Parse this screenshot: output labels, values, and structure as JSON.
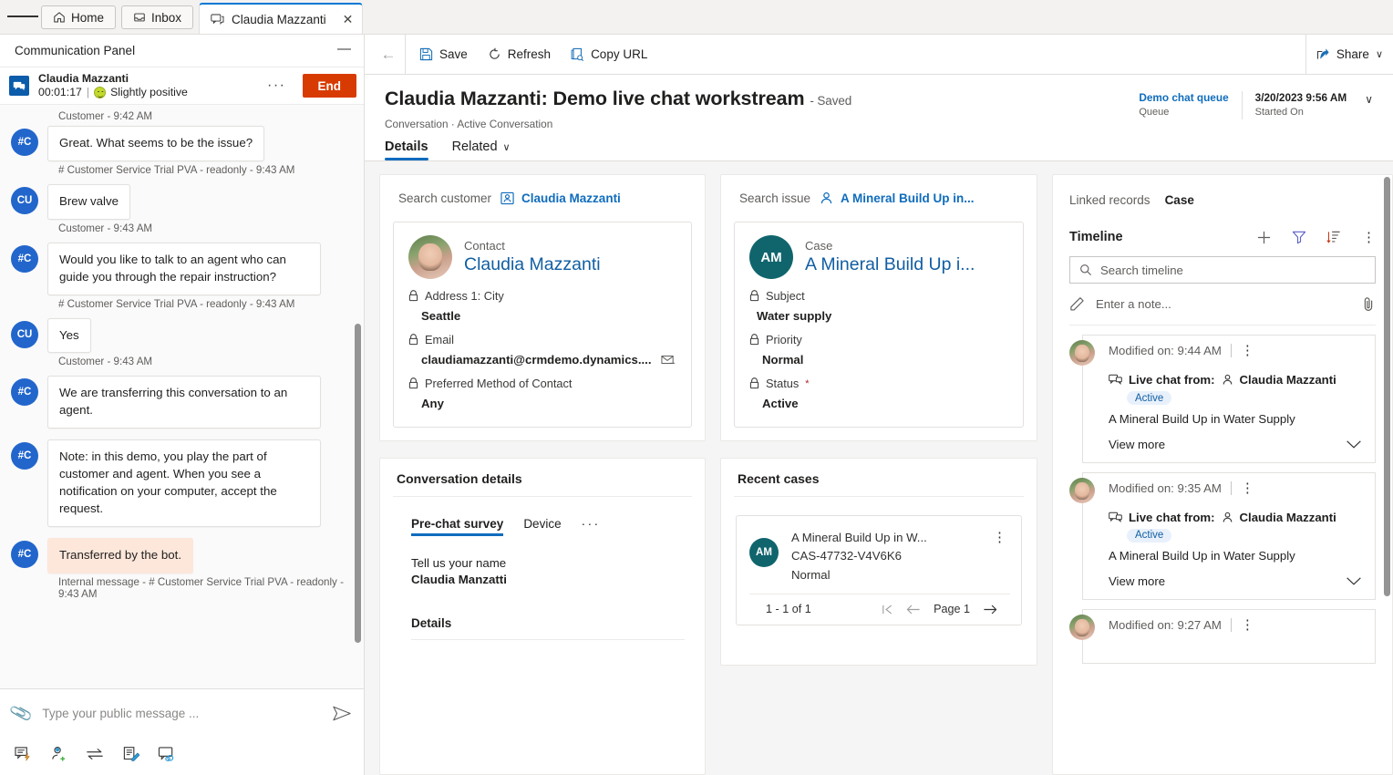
{
  "tabstrip": {
    "menu_icon": "hamburger-icon",
    "tabs": [
      {
        "label": "Home",
        "icon": "home-icon",
        "active": false
      },
      {
        "label": "Inbox",
        "icon": "inbox-icon",
        "active": false
      },
      {
        "label": "Claudia Mazzanti",
        "icon": "chat-icon",
        "active": true,
        "close": "✕"
      }
    ]
  },
  "communication_panel": {
    "title": "Communication Panel",
    "minimize_label": "—",
    "session": {
      "name": "Claudia Mazzanti",
      "timer": "00:01:17",
      "separator": "|",
      "sentiment": "Slightly positive",
      "sentiment_icon": "smiley-icon",
      "overflow_label": "···",
      "end_label": "End"
    },
    "messages": [
      {
        "meta_above": "Customer - 9:42 AM",
        "avatar": "#C",
        "text": "Great. What seems to be the issue?",
        "meta_below": "# Customer Service Trial PVA - readonly - 9:43 AM",
        "internal": false
      },
      {
        "meta_above": "",
        "avatar": "CU",
        "text": "Brew valve",
        "meta_below": "Customer - 9:43 AM",
        "internal": false
      },
      {
        "meta_above": "",
        "avatar": "#C",
        "text": "Would you like to talk to an agent who can guide you through the repair instruction?",
        "meta_below": "# Customer Service Trial PVA - readonly - 9:43 AM",
        "internal": false
      },
      {
        "meta_above": "",
        "avatar": "CU",
        "text": "Yes",
        "meta_below": "Customer - 9:43 AM",
        "internal": false
      },
      {
        "meta_above": "",
        "avatar": "#C",
        "text": "We are transferring this conversation to an agent.",
        "meta_below": "",
        "internal": false
      },
      {
        "meta_above": "",
        "avatar": "#C",
        "text": "Note: in this demo, you play the part of customer and agent. When you see a notification on your computer, accept the request.",
        "meta_below": "",
        "internal": false
      },
      {
        "meta_above": "",
        "avatar": "#C",
        "text": "Transferred by the bot.",
        "meta_below": "Internal message - # Customer Service Trial PVA - readonly - 9:43 AM",
        "internal": true
      }
    ],
    "composer": {
      "attach_icon": "paperclip-icon",
      "placeholder": "Type your public message ...",
      "value": "",
      "send_icon": "send-icon"
    },
    "tools": [
      {
        "name": "quick-reply-icon"
      },
      {
        "name": "consult-icon"
      },
      {
        "name": "transfer-icon"
      },
      {
        "name": "notes-icon"
      },
      {
        "name": "linked-conversation-icon"
      }
    ]
  },
  "command_bar": {
    "back_icon": "back-arrow-icon",
    "buttons": [
      {
        "label": "Save",
        "icon": "save-icon"
      },
      {
        "label": "Refresh",
        "icon": "refresh-icon"
      },
      {
        "label": "Copy URL",
        "icon": "copy-url-icon"
      }
    ],
    "share": {
      "label": "Share",
      "icon": "share-icon",
      "chevron": "∨"
    }
  },
  "record": {
    "title": "Claudia Mazzanti: Demo live chat workstream",
    "saved_state": "- Saved",
    "breadcrumb": "Conversation · Active Conversation",
    "header_fields": [
      {
        "value": "Demo chat queue",
        "label": "Queue",
        "is_link": true
      },
      {
        "value": "3/20/2023 9:56 AM",
        "label": "Started On",
        "is_link": false
      }
    ],
    "header_chevron": "∨",
    "tabs": [
      {
        "label": "Details",
        "active": true,
        "chevron": ""
      },
      {
        "label": "Related",
        "active": false,
        "chevron": "∨"
      }
    ]
  },
  "customer_card": {
    "search_label": "Search customer",
    "search_value": "Claudia Mazzanti",
    "search_icon": "contact-icon",
    "entity_type": "Contact",
    "entity_name": "Claudia Mazzanti",
    "avatar": "photo-avatar",
    "fields": [
      {
        "label": "Address 1: City",
        "value": "Seattle",
        "lock": true,
        "required": false,
        "trailing_icon": ""
      },
      {
        "label": "Email",
        "value": "claudiamazzanti@crmdemo.dynamics....",
        "lock": true,
        "required": false,
        "trailing_icon": "email-icon"
      },
      {
        "label": "Preferred Method of Contact",
        "value": "Any",
        "lock": true,
        "required": false,
        "trailing_icon": ""
      }
    ]
  },
  "case_card": {
    "search_label": "Search issue",
    "search_value": "A Mineral Build Up in...",
    "search_icon": "person-icon",
    "entity_type": "Case",
    "entity_name": "A Mineral Build Up i...",
    "initials": "AM",
    "fields": [
      {
        "label": "Subject",
        "value": "Water supply",
        "lock": true,
        "required": false
      },
      {
        "label": "Priority",
        "value": "Normal",
        "lock": true,
        "required": false
      },
      {
        "label": "Status",
        "value": "Active",
        "lock": true,
        "required": true
      }
    ]
  },
  "conversation_details": {
    "title": "Conversation details",
    "tabs": [
      {
        "label": "Pre-chat survey",
        "active": true
      },
      {
        "label": "Device",
        "active": false
      },
      {
        "label": "···",
        "active": false
      }
    ],
    "survey": {
      "question": "Tell us your name",
      "answer": "Claudia Manzatti"
    },
    "details_heading": "Details"
  },
  "recent_cases": {
    "title": "Recent cases",
    "items": [
      {
        "initials": "AM",
        "title": "A Mineral Build Up in W...",
        "number": "CAS-47732-V4V6K6",
        "priority": "Normal",
        "kebab": "⋮"
      }
    ],
    "count": "1 - 1 of 1",
    "first_icon": "first-page-icon",
    "prev_icon": "previous-page-icon",
    "page_label": "Page 1",
    "next_icon": "next-page-icon"
  },
  "timeline_panel": {
    "linked_records_label": "Linked records",
    "linked_records_value": "Case",
    "title": "Timeline",
    "actions": [
      {
        "name": "add-record-icon",
        "glyph": "+"
      },
      {
        "name": "filter-icon",
        "glyph": "▽"
      },
      {
        "name": "sort-icon",
        "glyph": "↓"
      },
      {
        "name": "more-commands-icon",
        "glyph": "⋮"
      }
    ],
    "search": {
      "placeholder": "Search timeline",
      "value": "",
      "icon": "search-icon"
    },
    "note": {
      "placeholder": "Enter a note...",
      "edit_icon": "pencil-icon",
      "attach_icon": "paperclip-icon"
    },
    "items": [
      {
        "modified": "Modified on: 9:44 AM",
        "kebab": "⋮",
        "channel_icon": "live-chat-icon",
        "subject_prefix": "Live chat from:",
        "person_icon": "person-icon",
        "person": "Claudia Mazzanti",
        "badge": "Active",
        "description": "A Mineral Build Up in Water Supply",
        "view_more": "View more",
        "chevron": "∨"
      },
      {
        "modified": "Modified on: 9:35 AM",
        "kebab": "⋮",
        "channel_icon": "live-chat-icon",
        "subject_prefix": "Live chat from:",
        "person_icon": "person-icon",
        "person": "Claudia Mazzanti",
        "badge": "Active",
        "description": "A Mineral Build Up in Water Supply",
        "view_more": "View more",
        "chevron": "∨"
      },
      {
        "modified": "Modified on: 9:27 AM",
        "kebab": "⋮",
        "channel_icon": "",
        "subject_prefix": "",
        "person_icon": "",
        "person": "",
        "badge": "",
        "description": "",
        "view_more": "",
        "chevron": ""
      }
    ]
  },
  "colors": {
    "accent": "#0f6cbd",
    "end_button": "#d83b01",
    "case_avatar": "#10656d",
    "bot_avatar": "#2266cc",
    "internal_bubble": "#fde7db"
  }
}
